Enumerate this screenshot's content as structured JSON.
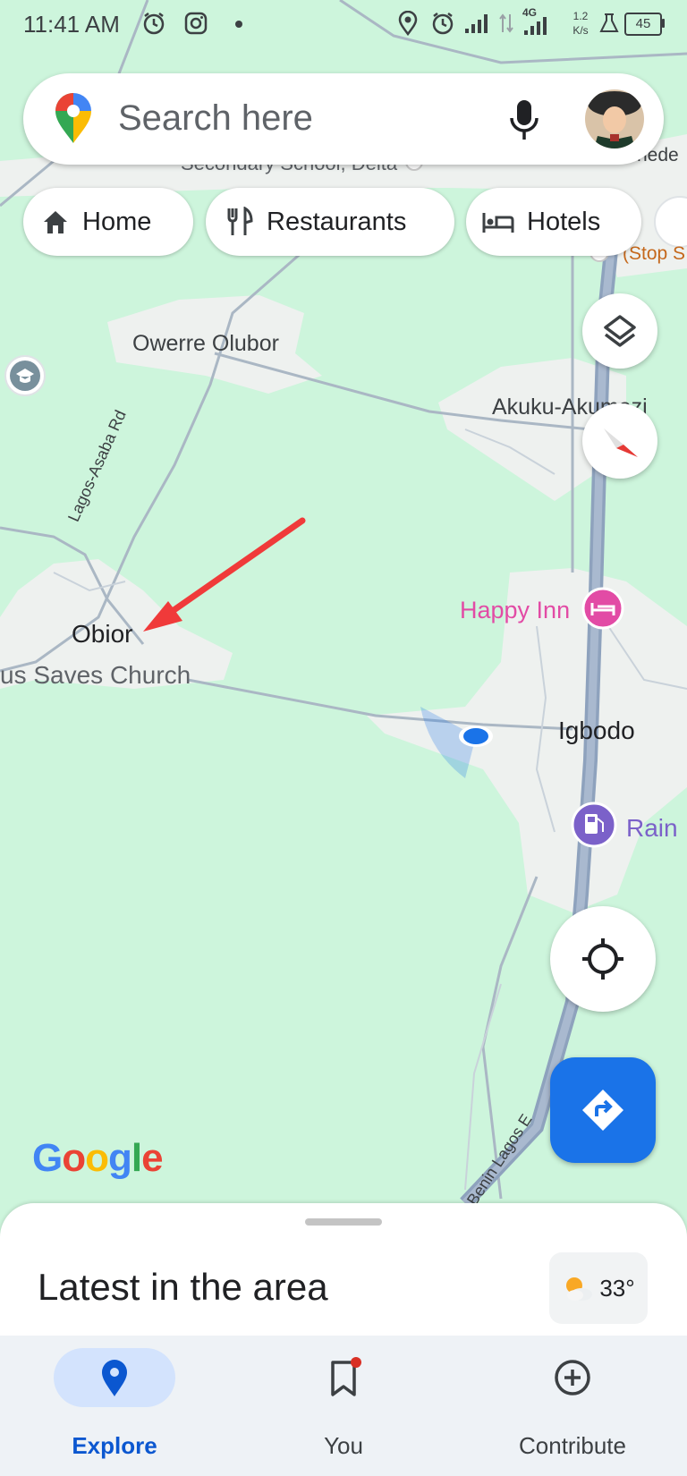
{
  "status_bar": {
    "time": "11:41 AM",
    "net_speed_value": "1.2",
    "net_speed_unit": "K/s",
    "network_type": "4G",
    "battery": "45"
  },
  "search": {
    "placeholder": "Search here"
  },
  "chips": [
    {
      "label": "Home",
      "icon": "home-icon"
    },
    {
      "label": "Restaurants",
      "icon": "restaurant-icon"
    },
    {
      "label": "Hotels",
      "icon": "hotel-icon"
    }
  ],
  "map": {
    "labels": {
      "school_partial": "Secondary School, Delta",
      "top_right_partial": "hede",
      "stop_partial": "(Stop S",
      "owerre": "Owerre Olubor",
      "akuku": "Akuku-Akumazi",
      "road_lagos_asaba": "Lagos-Asaba Rd",
      "obior": "Obior",
      "church": "us Saves Church",
      "happy_inn": "Happy Inn",
      "igbodo": "Igbodo",
      "rain": "Rain",
      "road_benin": "Benin Lagos E"
    },
    "colors": {
      "land": "#cdf5dc",
      "settlement": "#f1f3f4",
      "highway": "#9aa9bd",
      "hotel_pink": "#e24ba5",
      "gas_purple": "#7b61c9",
      "arrow_red": "#f03a3a",
      "location_blue": "#1a73e8"
    }
  },
  "google_logo": [
    "G",
    "o",
    "o",
    "g",
    "l",
    "e"
  ],
  "sheet": {
    "title": "Latest in the area",
    "temperature": "33°"
  },
  "nav": [
    {
      "label": "Explore",
      "icon": "explore-pin-icon",
      "active": true
    },
    {
      "label": "You",
      "icon": "bookmark-icon",
      "active": false
    },
    {
      "label": "Contribute",
      "icon": "add-circle-icon",
      "active": false
    }
  ]
}
